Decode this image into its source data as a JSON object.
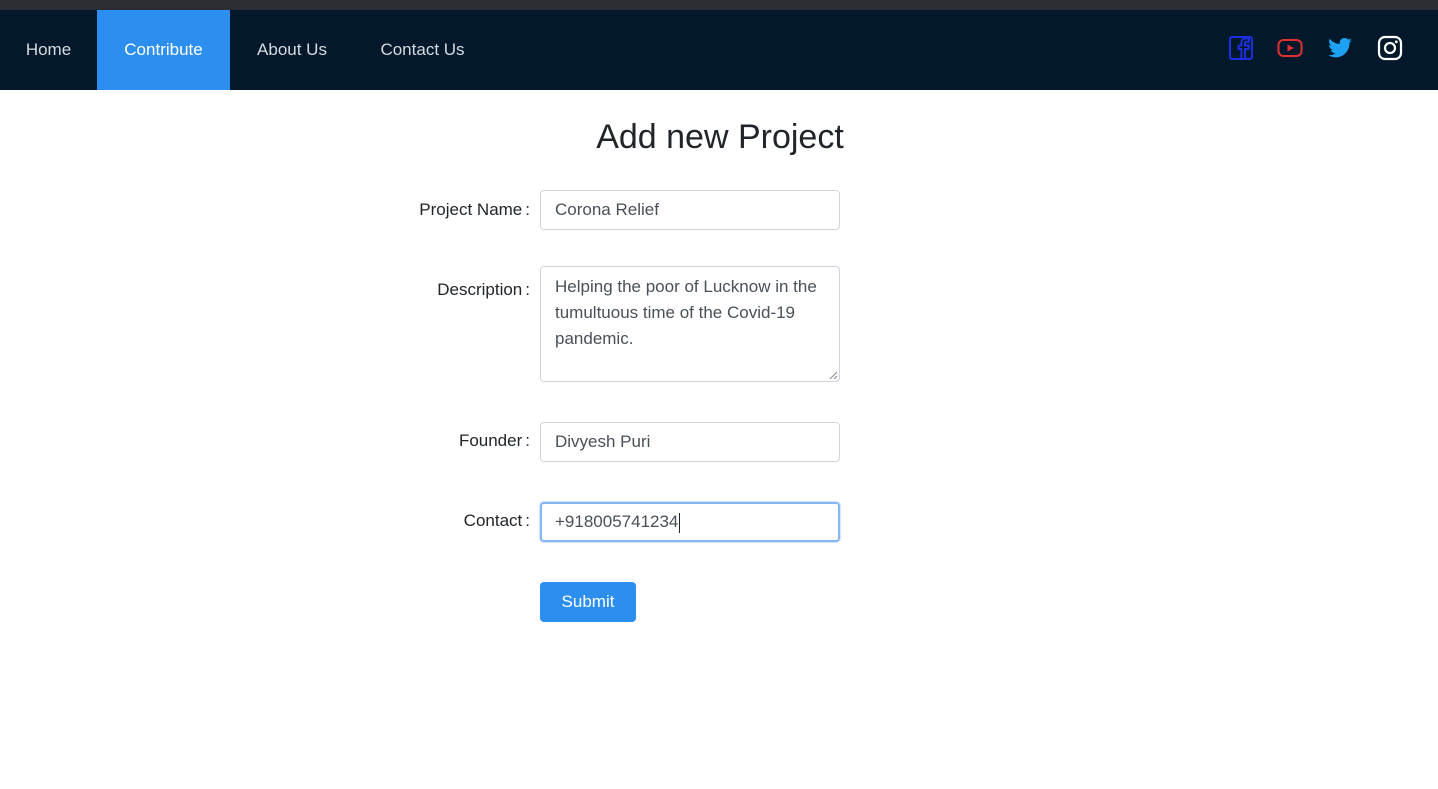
{
  "nav": {
    "items": [
      {
        "label": "Home",
        "active": false
      },
      {
        "label": "Contribute",
        "active": true
      },
      {
        "label": "About Us",
        "active": false
      },
      {
        "label": "Contact Us",
        "active": false
      }
    ],
    "social_icons": [
      "facebook-icon",
      "youtube-icon",
      "twitter-icon",
      "instagram-icon"
    ]
  },
  "form": {
    "title": "Add new Project",
    "fields": {
      "project_name": {
        "label": "Project Name",
        "value": "Corona Relief"
      },
      "description": {
        "label": "Description",
        "value": "Helping the poor of Lucknow in the tumultuous time of the Covid-19 pandemic."
      },
      "founder": {
        "label": "Founder",
        "value": "Divyesh Puri"
      },
      "contact": {
        "label": "Contact",
        "value": "+918005741234"
      }
    },
    "colon": ":",
    "submit_label": "Submit"
  },
  "colors": {
    "navbar_bg": "#03182b",
    "accent": "#2c8ff0",
    "facebook": "#1a2fe0",
    "youtube": "#e0302f",
    "twitter": "#1da1f2",
    "instagram": "#ffffff"
  }
}
